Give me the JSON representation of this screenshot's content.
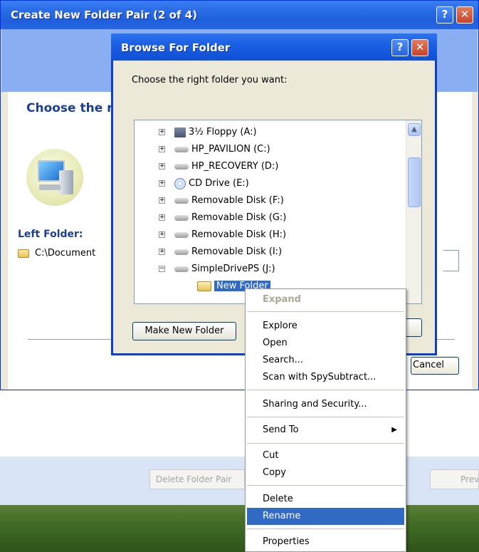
{
  "background_window": {
    "title": "Create New Folder Pair (2 of 4)",
    "help_glyph": "?",
    "close_glyph": "✕",
    "heading": "Choose the r",
    "left_folder_label": "Left Folder:",
    "left_folder_value": "C:\\Document",
    "cancel_label": "Cancel"
  },
  "bottom_buttons": {
    "delete_pair_label": "Delete Folder Pair",
    "previous_label": "Prev"
  },
  "dialog": {
    "title": "Browse For Folder",
    "help_glyph": "?",
    "close_glyph": "✕",
    "instruction": "Choose the right folder you want:",
    "make_new_folder_label": "Make New Folder",
    "tree_items": [
      {
        "label": "3½ Floppy (A:)",
        "icon": "floppy-drive-icon",
        "expander": "+"
      },
      {
        "label": "HP_PAVILION (C:)",
        "icon": "hard-drive-icon",
        "expander": "+"
      },
      {
        "label": "HP_RECOVERY (D:)",
        "icon": "hard-drive-icon",
        "expander": "+"
      },
      {
        "label": "CD Drive (E:)",
        "icon": "cd-drive-icon",
        "expander": "+"
      },
      {
        "label": "Removable Disk (F:)",
        "icon": "removable-disk-icon",
        "expander": "+"
      },
      {
        "label": "Removable Disk (G:)",
        "icon": "removable-disk-icon",
        "expander": "+"
      },
      {
        "label": "Removable Disk (H:)",
        "icon": "removable-disk-icon",
        "expander": "+"
      },
      {
        "label": "Removable Disk (I:)",
        "icon": "removable-disk-icon",
        "expander": "+"
      },
      {
        "label": "SimpleDrivePS (J:)",
        "icon": "removable-disk-icon",
        "expander": "−"
      },
      {
        "label": "New Folder",
        "icon": "open-folder-icon",
        "selected": true
      }
    ]
  },
  "context_menu": {
    "items": [
      {
        "label": "Expand",
        "disabled": true
      },
      {
        "label": "Explore"
      },
      {
        "label": "Open"
      },
      {
        "label": "Search..."
      },
      {
        "label": "Scan with SpySubtract..."
      },
      {
        "label": "Sharing and Security..."
      },
      {
        "label": "Send To",
        "submenu": "▶"
      },
      {
        "label": "Cut"
      },
      {
        "label": "Copy"
      },
      {
        "label": "Delete"
      },
      {
        "label": "Rename",
        "highlighted": true
      },
      {
        "label": "Properties"
      }
    ]
  },
  "colors": {
    "titlebar_blue": "#2c6ee8",
    "selection_blue": "#316ac5",
    "dialog_face": "#ece9d8"
  }
}
